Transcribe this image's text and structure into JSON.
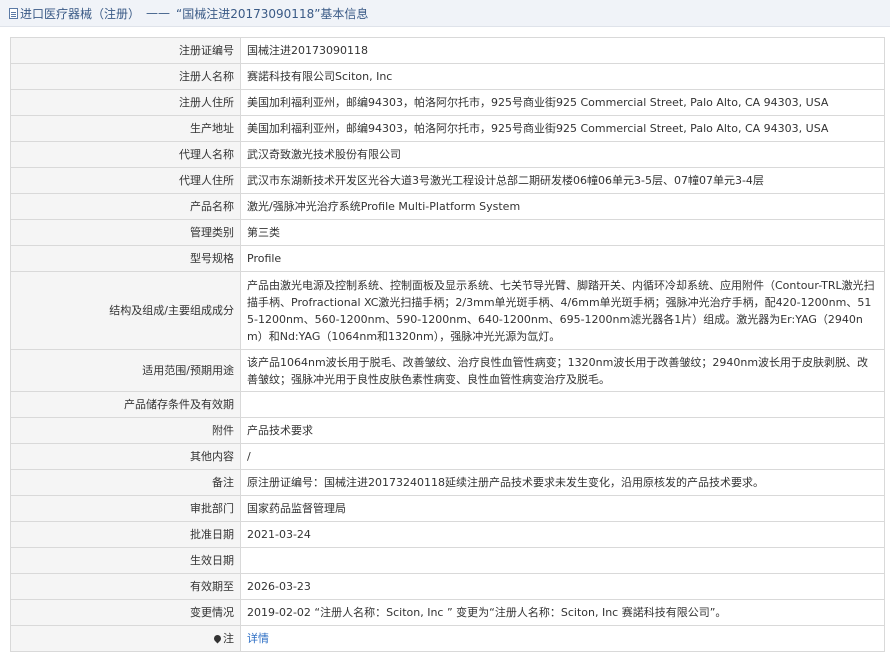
{
  "header": {
    "category": "进口医疗器械（注册）",
    "separator": "——",
    "title": "“国械注进20173090118”基本信息"
  },
  "rows": [
    {
      "label": "注册证编号",
      "value": "国械注进20173090118"
    },
    {
      "label": "注册人名称",
      "value": "赛諾科技有限公司Sciton, Inc"
    },
    {
      "label": "注册人住所",
      "value": "美国加利福利亚州，邮编94303，帕洛阿尔托市，925号商业街925 Commercial Street, Palo Alto, CA 94303, USA"
    },
    {
      "label": "生产地址",
      "value": "美国加利福利亚州，邮编94303，帕洛阿尔托市，925号商业街925 Commercial Street, Palo Alto, CA 94303, USA"
    },
    {
      "label": "代理人名称",
      "value": "武汉奇致激光技术股份有限公司"
    },
    {
      "label": "代理人住所",
      "value": "武汉市东湖新技术开发区光谷大道3号激光工程设计总部二期研发楼06幢06单元3-5层、07幢07单元3-4层"
    },
    {
      "label": "产品名称",
      "value": "激光/强脉冲光治疗系统Profile Multi-Platform System"
    },
    {
      "label": "管理类别",
      "value": "第三类"
    },
    {
      "label": "型号规格",
      "value": "Profile"
    },
    {
      "label": "结构及组成/主要组成成分",
      "value": "产品由激光电源及控制系统、控制面板及显示系统、七关节导光臂、脚踏开关、内循环冷却系统、应用附件（Contour-TRL激光扫描手柄、Profractional XC激光扫描手柄；2/3mm单光斑手柄、4/6mm单光斑手柄；强脉冲光治疗手柄，配420-1200nm、515-1200nm、560-1200nm、590-1200nm、640-1200nm、695-1200nm滤光器各1片）组成。激光器为Er:YAG（2940nm）和Nd:YAG（1064nm和1320nm），强脉冲光光源为氙灯。"
    },
    {
      "label": "适用范围/预期用途",
      "value": "该产品1064nm波长用于脱毛、改善皱纹、治疗良性血管性病变；1320nm波长用于改善皱纹；2940nm波长用于皮肤剥脱、改善皱纹；强脉冲光用于良性皮肤色素性病变、良性血管性病变治疗及脱毛。"
    },
    {
      "label": "产品储存条件及有效期",
      "value": ""
    },
    {
      "label": "附件",
      "value": "产品技术要求"
    },
    {
      "label": "其他内容",
      "value": "/"
    },
    {
      "label": "备注",
      "value": "原注册证编号：国械注进20173240118延续注册产品技术要求未发生变化，沿用原核发的产品技术要求。"
    },
    {
      "label": "审批部门",
      "value": "国家药品监督管理局"
    },
    {
      "label": "批准日期",
      "value": "2021-03-24"
    },
    {
      "label": "生效日期",
      "value": ""
    },
    {
      "label": "有效期至",
      "value": "2026-03-23"
    },
    {
      "label": "变更情况",
      "value": "2019-02-02 “注册人名称：Sciton, Inc ” 变更为“注册人名称：Sciton, Inc 赛諾科技有限公司”。"
    }
  ],
  "note": {
    "label": "注",
    "link": "详情",
    "icon": "pin-icon"
  },
  "colors": {
    "link": "#2c6ec4",
    "header_bg": "#f0f3f8",
    "label_bg": "#f5f5f5"
  }
}
